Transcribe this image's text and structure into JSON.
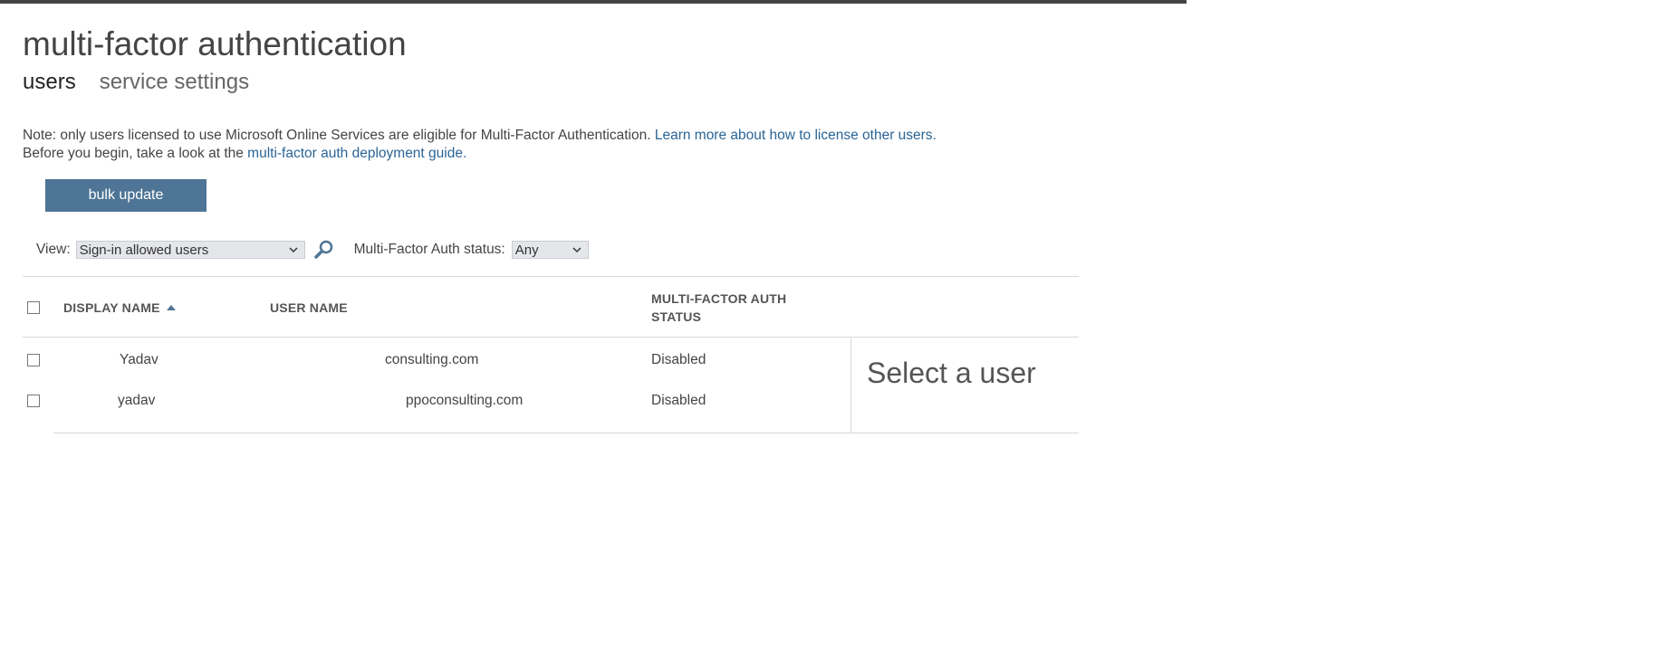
{
  "page": {
    "title": "multi-factor authentication"
  },
  "tabs": [
    {
      "label": "users",
      "active": true
    },
    {
      "label": "service settings",
      "active": false
    }
  ],
  "note": {
    "line1_text": "Note: only users licensed to use Microsoft Online Services are eligible for Multi-Factor Authentication. ",
    "line1_link": "Learn more about how to license other users.",
    "line2_text": "Before you begin, take a look at the ",
    "line2_link": "multi-factor auth deployment guide."
  },
  "toolbar": {
    "bulk_update_label": "bulk update"
  },
  "filters": {
    "view_label": "View:",
    "view_value": "Sign-in allowed users",
    "status_label": "Multi-Factor Auth status:",
    "status_value": "Any"
  },
  "table": {
    "headers": {
      "display_name": "DISPLAY NAME",
      "user_name": "USER NAME",
      "mfa_status_line1": "MULTI-FACTOR AUTH",
      "mfa_status_line2": "STATUS"
    },
    "rows": [
      {
        "display_name": "Yadav",
        "user_name": "consulting.com",
        "status": "Disabled"
      },
      {
        "display_name": "yadav",
        "user_name": "ppoconsulting.com",
        "status": "Disabled"
      }
    ]
  },
  "detail": {
    "placeholder": "Select a user"
  },
  "colors": {
    "accent": "#4e7595",
    "link": "#2a6496",
    "topbar": "#444444"
  },
  "icons": {
    "search": "search-icon",
    "chevron": "chevron-down-icon",
    "sort": "sort-ascending-icon"
  }
}
